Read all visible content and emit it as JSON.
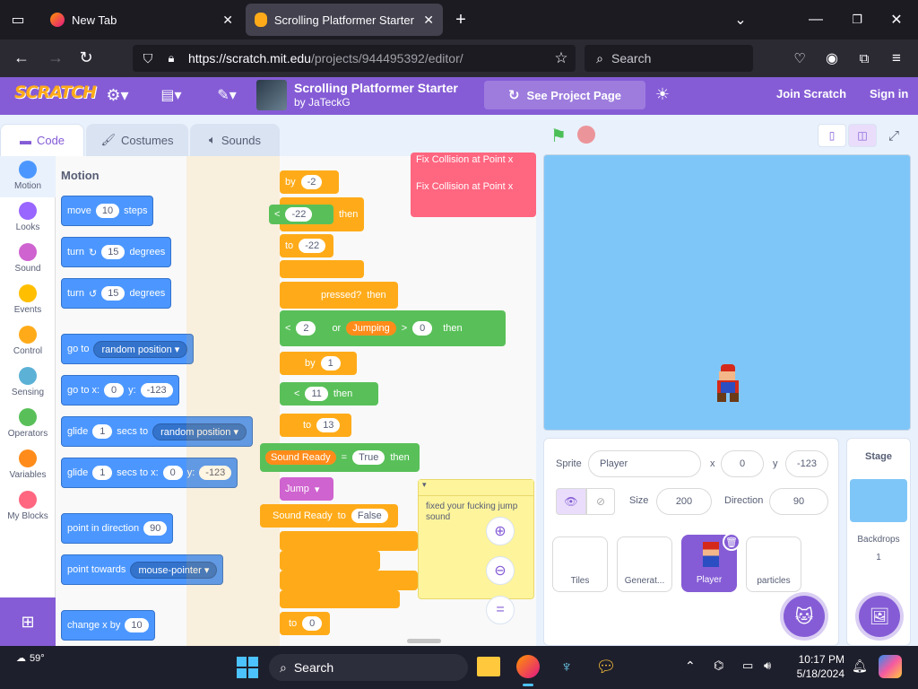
{
  "browser": {
    "tabs": [
      {
        "label": "New Tab"
      },
      {
        "label": "Scrolling Platformer Starter on"
      }
    ],
    "url_host": "https://scratch.mit.edu",
    "url_path": "/projects/944495392/editor/",
    "search_placeholder": "Search"
  },
  "menu": {
    "logo": "SCRATCH",
    "project_title": "Scrolling Platformer Starter",
    "project_author": "by JaTeckG",
    "see_project_page": "See Project Page",
    "join": "Join Scratch",
    "signin": "Sign in"
  },
  "editor_tabs": {
    "code": "Code",
    "costumes": "Costumes",
    "sounds": "Sounds"
  },
  "categories": [
    {
      "label": "Motion",
      "color": "#4c97ff"
    },
    {
      "label": "Looks",
      "color": "#9966ff"
    },
    {
      "label": "Sound",
      "color": "#cf63cf"
    },
    {
      "label": "Events",
      "color": "#ffbf00"
    },
    {
      "label": "Control",
      "color": "#ffab19"
    },
    {
      "label": "Sensing",
      "color": "#5cb1d6"
    },
    {
      "label": "Operators",
      "color": "#59c059"
    },
    {
      "label": "Variables",
      "color": "#ff8c1a"
    },
    {
      "label": "My Blocks",
      "color": "#ff6680"
    }
  ],
  "palette": {
    "heading": "Motion",
    "move": {
      "a": "move",
      "v": "10",
      "b": "steps"
    },
    "turn_right": {
      "a": "turn",
      "v": "15",
      "b": "degrees"
    },
    "turn_left": {
      "a": "turn",
      "v": "15",
      "b": "degrees"
    },
    "goto": {
      "a": "go to",
      "d": "random position"
    },
    "goto_xy": {
      "a": "go to x:",
      "x": "0",
      "b": "y:",
      "y": "-123"
    },
    "glide1": {
      "a": "glide",
      "v": "1",
      "b": "secs to",
      "d": "random position"
    },
    "glide2": {
      "a": "glide",
      "v": "1",
      "b": "secs to x:",
      "x": "0",
      "c": "y:",
      "y": "-123"
    },
    "point_dir": {
      "a": "point in direction",
      "v": "90"
    },
    "point_towards": {
      "a": "point towards",
      "d": "mouse-pointer"
    },
    "change_x": {
      "a": "change x by",
      "v": "10"
    }
  },
  "script": {
    "fix1": "Fix Collision at Point x",
    "fix2": "Fix Collision at Point x",
    "by": "by",
    "by_v": "-2",
    "lt": "<",
    "lt_v": "-22",
    "then": "then",
    "to": "to",
    "to_v": "-22",
    "pressed": "pressed?",
    "lt2_v": "2",
    "or": "or",
    "jumping": "Jumping",
    "gt": ">",
    "gt_v": "0",
    "by2_v": "1",
    "lt3_v": "11",
    "to3_v": "13",
    "sound_ready": "Sound Ready",
    "eq": "=",
    "true": "True",
    "jump": "Jump",
    "sound_ready2": "Sound Ready",
    "false": "False",
    "to5_v": "0",
    "comment": "fixed your fucking jump sound"
  },
  "sprite_info": {
    "sprite_label": "Sprite",
    "sprite_name": "Player",
    "x_label": "x",
    "x": "0",
    "y_label": "y",
    "y": "-123",
    "size_label": "Size",
    "size": "200",
    "direction_label": "Direction",
    "direction": "90"
  },
  "sprites": [
    {
      "label": "Tiles"
    },
    {
      "label": "Generat..."
    },
    {
      "label": "Player"
    },
    {
      "label": "particles"
    }
  ],
  "stage_panel": {
    "title": "Stage",
    "backdrops_label": "Backdrops",
    "backdrops_count": "1"
  },
  "taskbar": {
    "weather": "59°",
    "search": "Search",
    "time": "10:17 PM",
    "date": "5/18/2024"
  },
  "colors": {
    "scratch_purple": "#855cd6",
    "motion_blue": "#4c97ff",
    "control_orange": "#ffab19",
    "operator_green": "#59c059"
  }
}
